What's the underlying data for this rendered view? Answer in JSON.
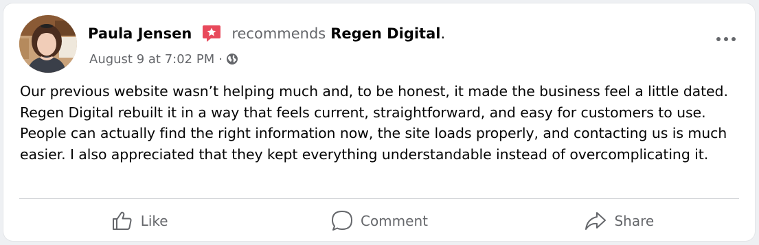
{
  "post": {
    "author_name": "Paula Jensen",
    "verb": "recommends",
    "page_name": "Regen Digital",
    "page_name_suffix": ".",
    "timestamp": "August 9 at 7:02 PM",
    "separator": "·",
    "audience_icon": "globe-icon",
    "recommend_icon": "recommend-star-icon",
    "body": "Our previous website wasn’t helping much and, to be honest, it made the business feel a little dated. Regen Digital rebuilt it in a way that feels current, straightforward, and easy for customers to use. People can actually find the right information now, the site loads properly, and contacting us is much easier. I also appreciated that they kept everything understandable instead of overcomplicating it."
  },
  "actions": {
    "like_label": "Like",
    "comment_label": "Comment",
    "share_label": "Share"
  },
  "colors": {
    "recommend_badge": "#e8495b",
    "secondary_text": "#65676b",
    "primary_text": "#050505"
  }
}
